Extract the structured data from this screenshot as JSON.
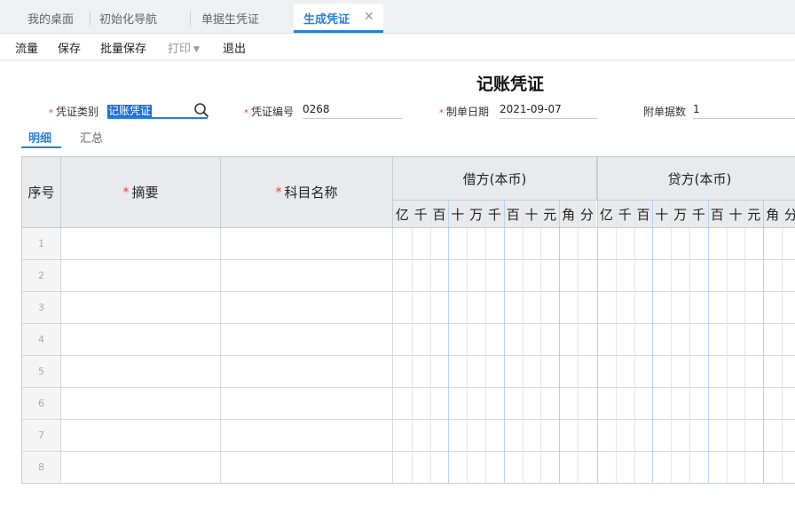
{
  "tabs": [
    {
      "label": "我的桌面"
    },
    {
      "label": "初始化导航"
    },
    {
      "label": "单据生凭证"
    },
    {
      "label": "生成凭证"
    }
  ],
  "toolbar": {
    "flow": "流量",
    "save": "保存",
    "batch_save": "批量保存",
    "print": "打印",
    "exit": "退出"
  },
  "voucher": {
    "title": "记账凭证",
    "type_label": "凭证类别",
    "type_value": "记账凭证",
    "number_label": "凭证编号",
    "number_value": "0268",
    "date_label": "制单日期",
    "date_value": "2021-09-07",
    "attach_label": "附单据数",
    "attach_value": "1"
  },
  "subtabs": {
    "detail": "明细",
    "summary": "汇总"
  },
  "grid": {
    "col_seq": "序号",
    "col_summary": "摘要",
    "col_subject": "科目名称",
    "debit_header": "借方(本币)",
    "credit_header": "贷方(本币)",
    "digits": [
      "亿",
      "千",
      "百",
      "十",
      "万",
      "千",
      "百",
      "十",
      "元",
      "角",
      "分"
    ],
    "rows": [
      "1",
      "2",
      "3",
      "4",
      "5",
      "6",
      "7",
      "8"
    ]
  },
  "colors": {
    "accent": "#2a7fd6",
    "required": "#e0453b",
    "header_bg": "#e9eaec"
  }
}
